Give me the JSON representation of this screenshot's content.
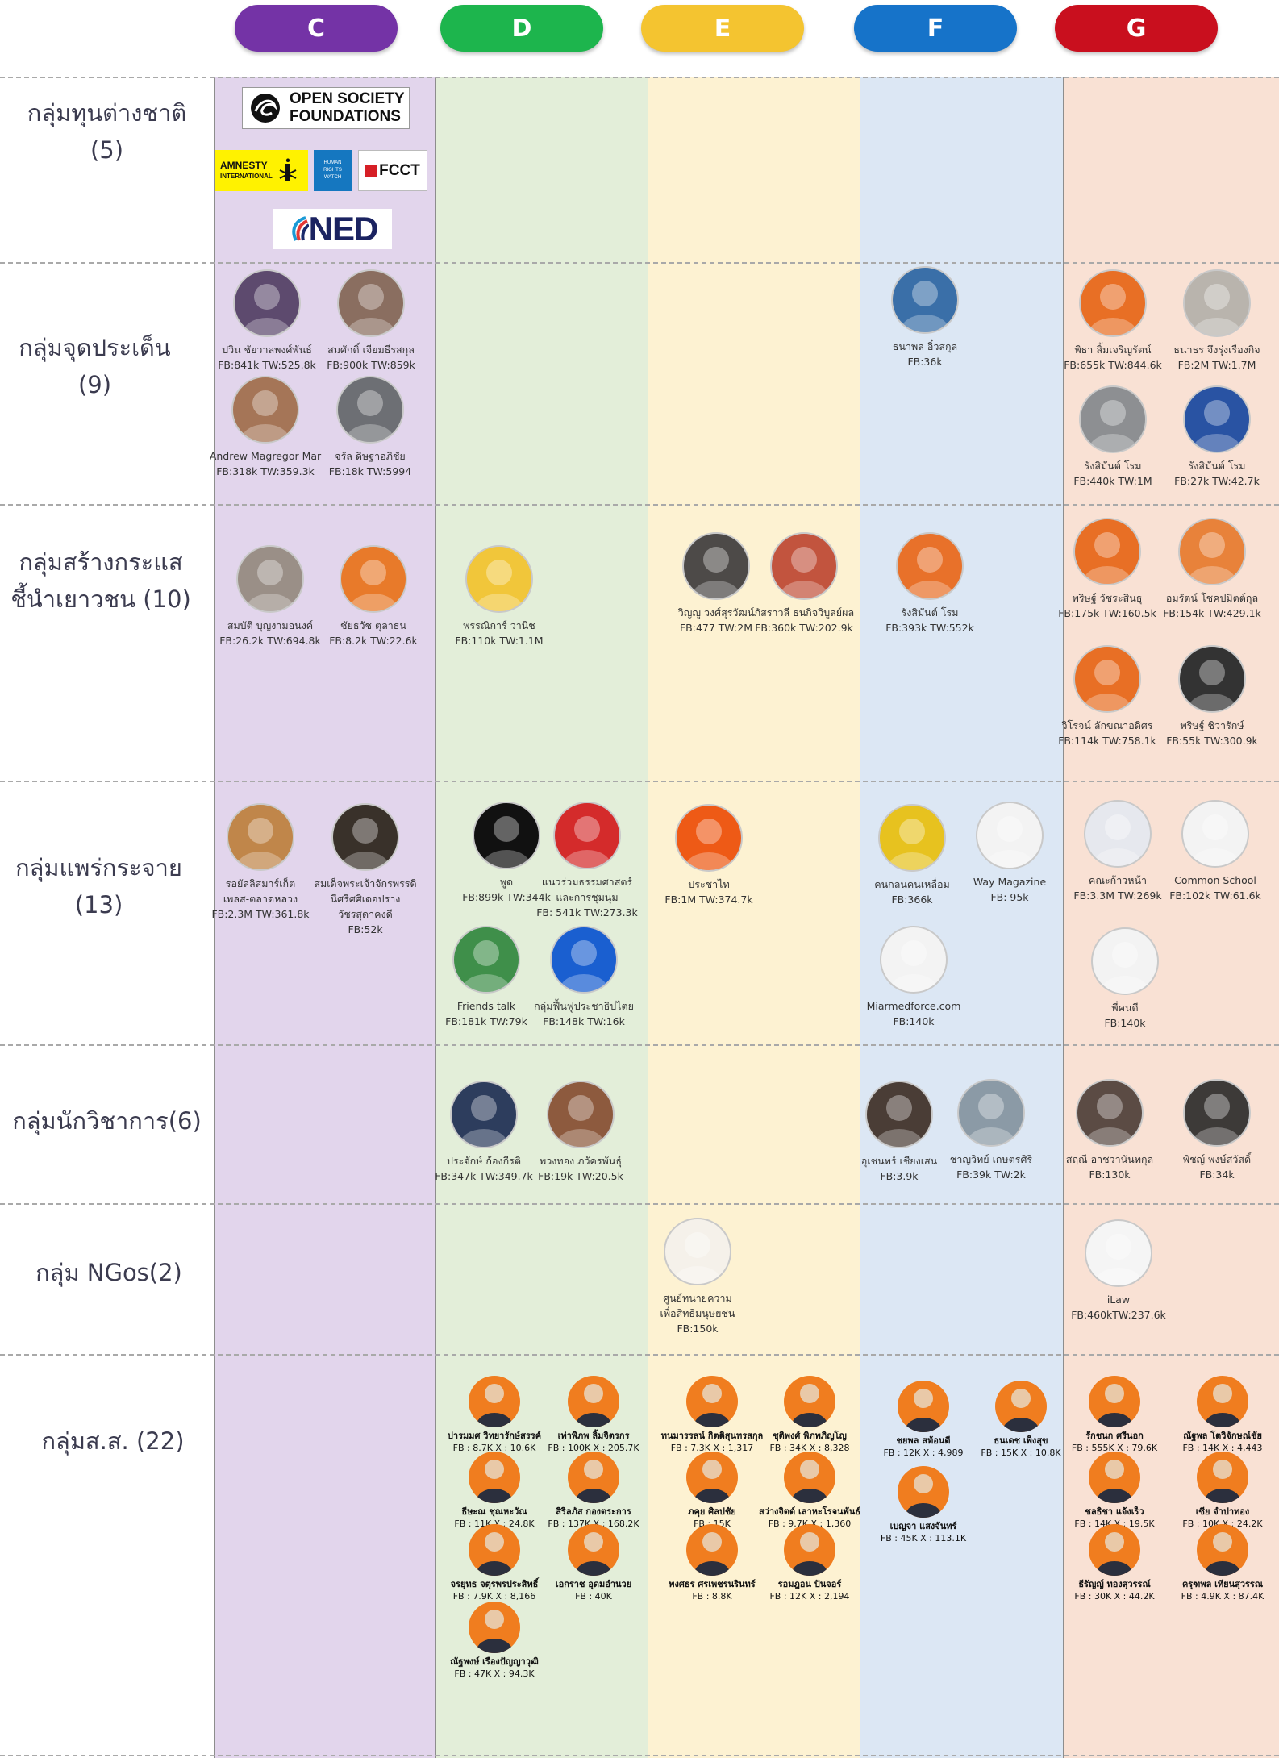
{
  "columns": [
    {
      "label": "C",
      "color": "#7433a6",
      "bg": "#e2d5ec"
    },
    {
      "label": "D",
      "color": "#1db54d",
      "bg": "#e3eed9"
    },
    {
      "label": "E",
      "color": "#f4c430",
      "bg": "#fdf2d2"
    },
    {
      "label": "F",
      "color": "#1673c9",
      "bg": "#dce7f4"
    },
    {
      "label": "G",
      "color": "#c90f1e",
      "bg": "#f9e1d4"
    }
  ],
  "groups": [
    {
      "label": "กลุ่มทุนต่างชาติ\n(5)"
    },
    {
      "label": "กลุ่มจุดประเด็น\n(9)"
    },
    {
      "label": "กลุ่มสร้างกระแส\nชี้นำเยาวชน (10)"
    },
    {
      "label": "กลุ่มแพร่กระจาย\n(13)"
    },
    {
      "label": "กลุ่มนักวิชาการ(6)"
    },
    {
      "label": "กลุ่ม NGos(2)"
    },
    {
      "label": "กลุ่มส.ส. (22)"
    }
  ],
  "logos": {
    "osf": {
      "line1": "OPEN SOCIETY",
      "line2": "FOUNDATIONS"
    },
    "amnesty": {
      "line1": "AMNESTY",
      "line2": "INTERNATIONAL"
    },
    "hrw": {
      "text": "HUMAN\nRIGHTS\nWATCH"
    },
    "fcct": {
      "text": "FCCT"
    },
    "ned": {
      "text": "NED"
    }
  },
  "people": [
    {
      "name": "ปวิน ชัยวาลพงศ์พันธ์",
      "stats": "FB:841k TW:525.8k",
      "color": "#5d4a6e"
    },
    {
      "name": "สมศักดิ์ เจียมธีรสกุล",
      "stats": "FB:900k TW:859k",
      "color": "#8a6e60"
    },
    {
      "name": "Andrew Magregor Mar",
      "stats": "FB:318k TW:359.3k",
      "color": "#a57557"
    },
    {
      "name": "จรัล ดิษฐาอภิชัย",
      "stats": "FB:18k TW:5994",
      "color": "#6d6f74"
    },
    {
      "name": "ธนาพล อิ๋วสกุล",
      "stats": "FB:36k",
      "color": "#3a6fa8"
    },
    {
      "name": "พิธา ลิ้มเจริญรัตน์",
      "stats": "FB:655k TW:844.6k",
      "color": "#e86f25"
    },
    {
      "name": "ธนาธร จึงรุ่งเรืองกิจ",
      "stats": "FB:2M TW:1.7M",
      "color": "#b9b4ad"
    },
    {
      "name": "รังสิมันต์ โรม",
      "stats": "FB:440k TW:1M",
      "color": "#8d8f92"
    },
    {
      "name": "รังสิมันต์ โรม",
      "stats": "FB:27k TW:42.7k",
      "color": "#2953a3"
    },
    {
      "name": "สมบัติ บุญงามอนงค์",
      "stats": "FB:26.2k TW:694.8k",
      "color": "#9a8f87"
    },
    {
      "name": "ชัยธวัช ตุลาธน",
      "stats": "FB:8.2k TW:22.6k",
      "color": "#e87a2a"
    },
    {
      "name": "พรรณิการ์ วานิช",
      "stats": "FB:110k TW:1.1M",
      "color": "#f1c63a"
    },
    {
      "name": "วิญญู วงศ์สุรวัฒน์",
      "stats": "FB:477 TW:2M",
      "color": "#4d4a48"
    },
    {
      "name": "ภัสราวลี ธนกิจวิบูลย์ผล",
      "stats": "FB:360k TW:202.9k",
      "color": "#c2543e"
    },
    {
      "name": "รังสิมันต์ โรม",
      "stats": "FB:393k TW:552k",
      "color": "#e8712a"
    },
    {
      "name": "พริษฐ์ วัชระสินธุ",
      "stats": "FB:175k TW:160.5k",
      "color": "#e86f25"
    },
    {
      "name": "อมรัตน์ โชคปมิตต์กุล",
      "stats": "FB:154k TW:429.1k",
      "color": "#e8823a"
    },
    {
      "name": "วิโรจน์ ลักขณาอดิศร",
      "stats": "FB:114k TW:758.1k",
      "color": "#e86f25"
    },
    {
      "name": "พริษฐ์ ชิวารักษ์",
      "stats": "FB:55k TW:300.9k",
      "color": "#333"
    },
    {
      "name": "รอยัลลิสมาร์เก็ต\nเพลส-ตลาดหลวง",
      "stats": "FB:2.3M TW:361.8k",
      "color": "#c0864a"
    },
    {
      "name": "สมเด็จพระเจ้าจักรพรรดิ\nนีศรีศศิเดอปราง\nวัชรสุดาคงดี",
      "stats": "FB:52k",
      "color": "#39312a"
    },
    {
      "name": "พูด",
      "stats": "FB:899k TW:344k",
      "color": "#111"
    },
    {
      "name": "แนวร่วมธรรมศาสตร์\nและการชุมนุม",
      "stats": "FB: 541k TW:273.3k",
      "color": "#d42b2b"
    },
    {
      "name": "Friends talk",
      "stats": "FB:181k TW:79k",
      "color": "#3f8f4a"
    },
    {
      "name": "กลุ่มฟื้นฟูประชาธิปไตย",
      "stats": "FB:148k TW:16k",
      "color": "#1a5fd0"
    },
    {
      "name": "ประชาไท",
      "stats": "FB:1M TW:374.7k",
      "color": "#ee5a16"
    },
    {
      "name": "คนกลนคนเหลื่อม",
      "stats": "FB:366k",
      "color": "#e7c21f"
    },
    {
      "name": "Way Magazine",
      "stats": "FB: 95k",
      "color": "#f3f3f3"
    },
    {
      "name": "Miarmedforce.com",
      "stats": "FB:140k",
      "color": "#f3f3f3"
    },
    {
      "name": "คณะก้าวหน้า",
      "stats": "FB:3.3M TW:269k",
      "color": "#e6e8ee"
    },
    {
      "name": "Common School",
      "stats": "FB:102k TW:61.6k",
      "color": "#f3f3f3"
    },
    {
      "name": "พี่คนดี",
      "stats": "FB:140k",
      "color": "#f3f3f3"
    },
    {
      "name": "ประจักษ์ ก้องกีรติ",
      "stats": "FB:347k TW:349.7k",
      "color": "#2d3d5d"
    },
    {
      "name": "พวงทอง ภวัครพันธุ์",
      "stats": "FB:19k TW:20.5k",
      "color": "#8d5a3e"
    },
    {
      "name": "อุเชนทร์ เชียงเสน",
      "stats": "FB:3.9k",
      "color": "#4a3d36"
    },
    {
      "name": "ชาญวิทย์ เกษตรศิริ",
      "stats": "FB:39k TW:2k",
      "color": "#8b9aa6"
    },
    {
      "name": "สฤณี อาชวานันทกุล",
      "stats": "FB:130k",
      "color": "#5b4b44"
    },
    {
      "name": "พิชญ์ พงษ์สวัสดิ์",
      "stats": "FB:34k",
      "color": "#3d3a38"
    },
    {
      "name": "ศูนย์ทนายความ\nเพื่อสิทธิมนุษยชน",
      "stats": "FB:150k",
      "color": "#f5f1ea"
    },
    {
      "name": "iLaw",
      "stats": "FB:460kTW:237.6k",
      "color": "#f5f5f5"
    }
  ],
  "mps": [
    {
      "name": "ปารมมศ วิทยารักษ์สรรค์",
      "stats": "FB : 8.7K X : 10.6K"
    },
    {
      "name": "เท่าพิภพ ลิ้มจิตรกร",
      "stats": "FB : 100K X : 205.7K"
    },
    {
      "name": "ธีษะณ ชุณหะวัณ",
      "stats": "FB : 11K X : 24.8K"
    },
    {
      "name": "สิริลภัส กองตระการ",
      "stats": "FB : 137K X : 168.2K"
    },
    {
      "name": "จรยุทธ จตุรพรประสิทธิ์",
      "stats": "FB : 7.9K X : 8,166"
    },
    {
      "name": "เอกราช อุดมอำนวย",
      "stats": "FB : 40K"
    },
    {
      "name": "ณัฐพงษ์ เรืองปัญญาวุฒิ",
      "stats": "FB : 47K X : 94.3K"
    },
    {
      "name": "ทนมารรสน์ กิตติสุนทรสกุล",
      "stats": "FB : 7.3K X : 1,317"
    },
    {
      "name": "ชุติพงศ์ พิภพภิญโญ",
      "stats": "FB : 34K X : 8,328"
    },
    {
      "name": "ภคุย ศิลปชัย",
      "stats": "FB : 15K"
    },
    {
      "name": "สว่างจิตต์ เลาหะโรจนพันธ์",
      "stats": "FB : 9.7K X : 1,360"
    },
    {
      "name": "พงศธร ศรเพชรนรินทร์",
      "stats": "FB : 8.8K"
    },
    {
      "name": "รอมฎอน ปันจอร์",
      "stats": "FB : 12K X : 2,194"
    },
    {
      "name": "ชยพล สท้อนดี",
      "stats": "FB : 12K X : 4,989"
    },
    {
      "name": "ธนเดช เพ็งสุข",
      "stats": "FB : 15K X : 10.8K"
    },
    {
      "name": "เบญจา แสงจันทร์",
      "stats": "FB : 45K X : 113.1K"
    },
    {
      "name": "รักชนก ศรีนอก",
      "stats": "FB : 555K X : 79.6K"
    },
    {
      "name": "ณัฐพล โตวิจักษณ์ชัย",
      "stats": "FB : 14K X : 4,443"
    },
    {
      "name": "ชลธิชา แจ้งเร็ว",
      "stats": "FB : 14K X : 19.5K"
    },
    {
      "name": "เซีย จำปาทอง",
      "stats": "FB : 10K X : 24.2K"
    },
    {
      "name": "ธีรัญญ์ ทองสุวรรณ์",
      "stats": "FB : 30K X : 44.2K"
    },
    {
      "name": "ครุฑพล เทียนสุวรรณ",
      "stats": "FB : 4.9K X : 87.4K"
    }
  ]
}
